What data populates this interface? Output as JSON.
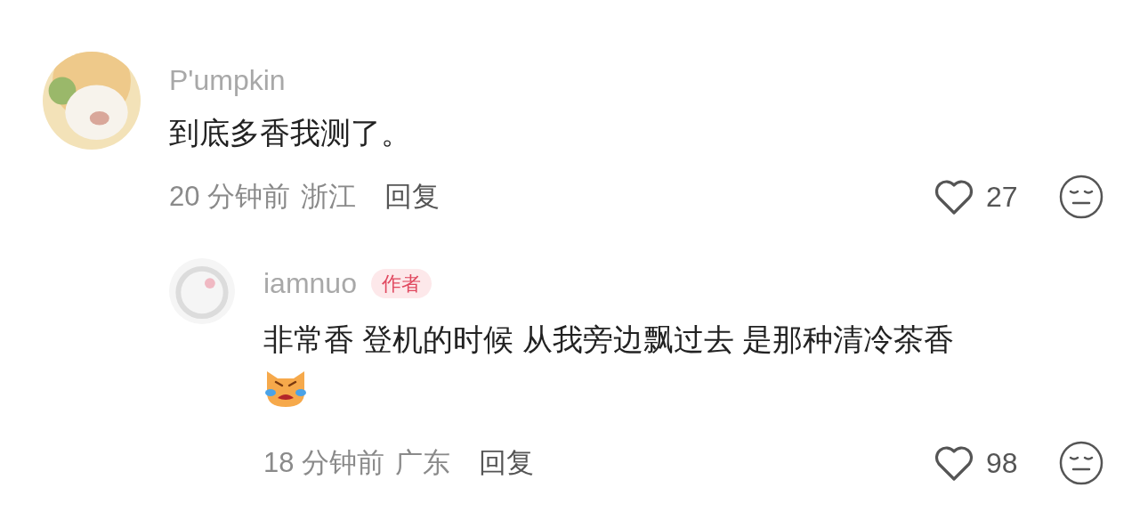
{
  "comments": [
    {
      "username": "P'umpkin",
      "text": "到底多香我测了。",
      "time": "20 分钟前",
      "location": "浙江",
      "reply_label": "回复",
      "likes": "27",
      "replies": [
        {
          "username": "iamnuo",
          "badge": "作者",
          "text": "非常香 登机的时候 从我旁边飘过去 是那种清冷茶香",
          "emoji": true,
          "time": "18 分钟前",
          "location": "广东",
          "reply_label": "回复",
          "likes": "98"
        }
      ]
    }
  ]
}
